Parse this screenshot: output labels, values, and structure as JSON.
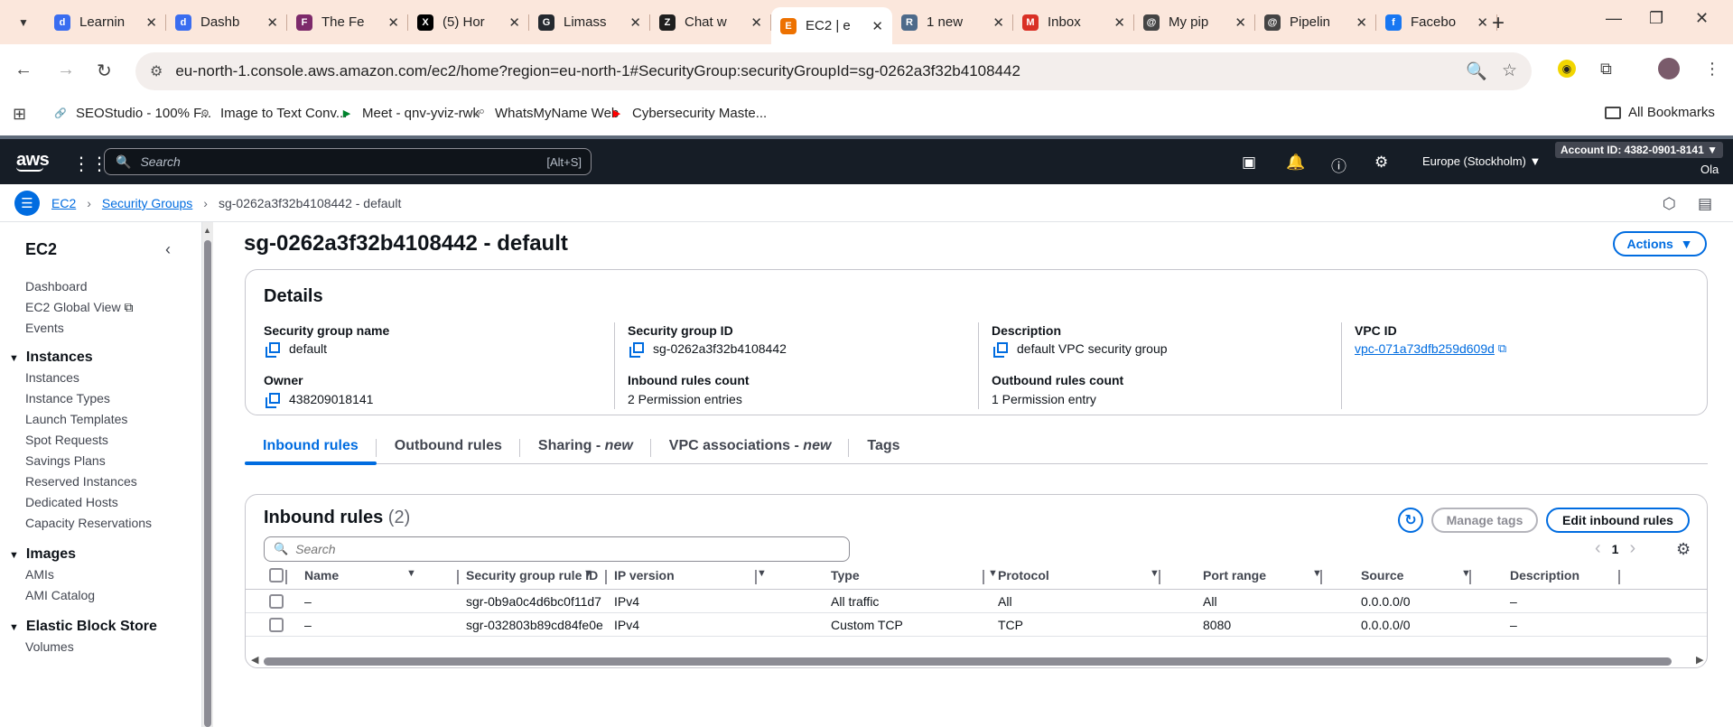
{
  "browser": {
    "tabs": [
      {
        "title": "Learnin",
        "color": "#3a6df0",
        "glyph": "d"
      },
      {
        "title": "Dashb",
        "color": "#3a6df0",
        "glyph": "d"
      },
      {
        "title": "The Fe",
        "color": "#7d2a6b",
        "glyph": "F"
      },
      {
        "title": "(5) Hor",
        "color": "#000000",
        "glyph": "X"
      },
      {
        "title": "Limass",
        "color": "#24292f",
        "glyph": "G"
      },
      {
        "title": "Chat w",
        "color": "#1f1f1f",
        "glyph": "Z"
      },
      {
        "title": "EC2 | e",
        "color": "#ed7100",
        "glyph": "E",
        "active": true
      },
      {
        "title": "1 new",
        "color": "#4d6a8a",
        "glyph": "R"
      },
      {
        "title": "Inbox",
        "color": "#d93025",
        "glyph": "M"
      },
      {
        "title": "My pip",
        "color": "#444444",
        "glyph": "@"
      },
      {
        "title": "Pipelin",
        "color": "#444444",
        "glyph": "@"
      },
      {
        "title": "Facebo",
        "color": "#1877f2",
        "glyph": "f"
      }
    ],
    "url": "eu-north-1.console.aws.amazon.com/ec2/home?region=eu-north-1#SecurityGroup:securityGroupId=sg-0262a3f32b4108442",
    "bookmarks": [
      {
        "label": "SEOStudio - 100% F...",
        "color": "#555",
        "glyph": "🔗"
      },
      {
        "label": "Image to Text Conv...",
        "color": "#555",
        "glyph": "⚙"
      },
      {
        "label": "Meet - qnv-yviz-rwk",
        "color": "#00832d",
        "glyph": "▶"
      },
      {
        "label": "WhatsMyName Web",
        "color": "#777",
        "glyph": "☍"
      },
      {
        "label": "Cybersecurity Maste...",
        "color": "#ff0000",
        "glyph": "▶"
      }
    ],
    "all_bookmarks": "All Bookmarks"
  },
  "aws": {
    "search_placeholder": "Search",
    "search_shortcut": "[Alt+S]",
    "region": "Europe (Stockholm)",
    "account": "Account ID: 4382-0901-8141",
    "user": "Ola"
  },
  "breadcrumb": {
    "ec2": "EC2",
    "security_groups": "Security Groups",
    "current": "sg-0262a3f32b4108442 - default"
  },
  "sidebar": {
    "title": "EC2",
    "items_top": [
      "Dashboard",
      "EC2 Global View",
      "Events"
    ],
    "sections": [
      {
        "title": "Instances",
        "items": [
          "Instances",
          "Instance Types",
          "Launch Templates",
          "Spot Requests",
          "Savings Plans",
          "Reserved Instances",
          "Dedicated Hosts",
          "Capacity Reservations"
        ]
      },
      {
        "title": "Images",
        "items": [
          "AMIs",
          "AMI Catalog"
        ]
      },
      {
        "title": "Elastic Block Store",
        "items": [
          "Volumes"
        ]
      }
    ]
  },
  "page": {
    "title": "sg-0262a3f32b4108442 - default",
    "actions": "Actions"
  },
  "details": {
    "heading": "Details",
    "sg_name_label": "Security group name",
    "sg_name": "default",
    "sg_id_label": "Security group ID",
    "sg_id": "sg-0262a3f32b4108442",
    "desc_label": "Description",
    "desc": "default VPC security group",
    "vpc_label": "VPC ID",
    "vpc": "vpc-071a73dfb259d609d",
    "owner_label": "Owner",
    "owner": "438209018141",
    "inbound_count_label": "Inbound rules count",
    "inbound_count": "2 Permission entries",
    "outbound_count_label": "Outbound rules count",
    "outbound_count": "1 Permission entry"
  },
  "content_tabs": {
    "inbound": "Inbound rules",
    "outbound": "Outbound rules",
    "sharing": "Sharing - ",
    "sharing_new": "new",
    "vpc_assoc": "VPC associations - ",
    "vpc_assoc_new": "new",
    "tags": "Tags"
  },
  "rules": {
    "heading": "Inbound rules",
    "count": "(2)",
    "manage_tags": "Manage tags",
    "edit": "Edit inbound rules",
    "search_placeholder": "Search",
    "page": "1",
    "columns": [
      "Name",
      "Security group rule ID",
      "IP version",
      "Type",
      "Protocol",
      "Port range",
      "Source",
      "Description"
    ],
    "rows": [
      [
        "–",
        "sgr-0b9a0c4d6bc0f11d7",
        "IPv4",
        "All traffic",
        "All",
        "All",
        "0.0.0.0/0",
        "–"
      ],
      [
        "–",
        "sgr-032803b89cd84fe0e",
        "IPv4",
        "Custom TCP",
        "TCP",
        "8080",
        "0.0.0.0/0",
        "–"
      ]
    ]
  }
}
